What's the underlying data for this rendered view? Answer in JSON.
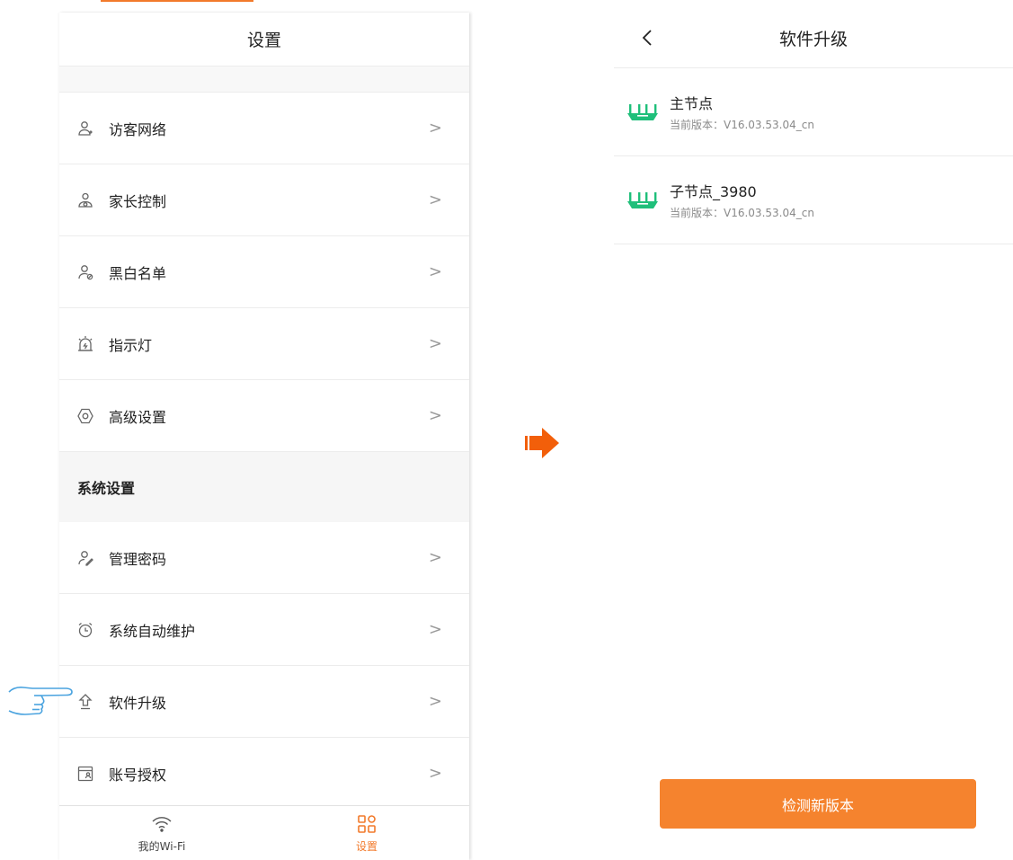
{
  "left": {
    "title": "设置",
    "items_top": [
      {
        "label": "访客网络",
        "icon": "guest-user-icon"
      },
      {
        "label": "家长控制",
        "icon": "parental-control-icon"
      },
      {
        "label": "黑白名单",
        "icon": "blacklist-icon"
      },
      {
        "label": "指示灯",
        "icon": "indicator-light-icon"
      },
      {
        "label": "高级设置",
        "icon": "advanced-settings-icon"
      }
    ],
    "section_label": "系统设置",
    "items_sys": [
      {
        "label": "管理密码",
        "icon": "admin-password-icon"
      },
      {
        "label": "系统自动维护",
        "icon": "clock-icon"
      },
      {
        "label": "软件升级",
        "icon": "upgrade-icon"
      },
      {
        "label": "账号授权",
        "icon": "account-auth-icon"
      }
    ],
    "chevron": ">",
    "tabs": [
      {
        "label": "我的Wi-Fi",
        "icon": "wifi-icon",
        "active": false
      },
      {
        "label": "设置",
        "icon": "settings-grid-icon",
        "active": true
      }
    ]
  },
  "right": {
    "title": "软件升级",
    "back_icon": "back-chevron-icon",
    "nodes": [
      {
        "name": "主节点",
        "version": "当前版本：V16.03.53.04_cn"
      },
      {
        "name": "子节点_3980",
        "version": "当前版本：V16.03.53.04_cn"
      }
    ],
    "check_button": "检测新版本"
  },
  "colors": {
    "accent": "#f27a2b",
    "router_green": "#1fbf7a"
  }
}
